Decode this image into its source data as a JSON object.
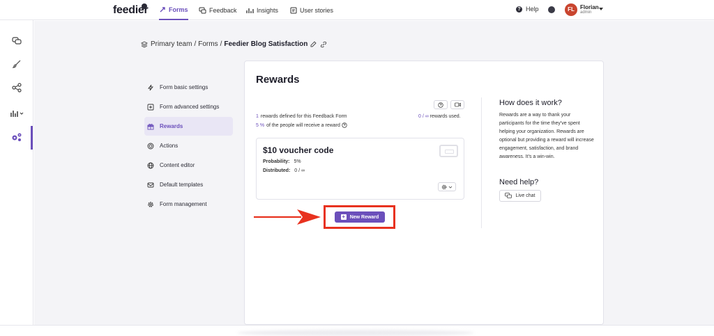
{
  "header": {
    "logo": "feedier",
    "nav": [
      {
        "label": "Forms",
        "active": true
      },
      {
        "label": "Feedback",
        "active": false
      },
      {
        "label": "Insights",
        "active": false
      },
      {
        "label": "User stories",
        "active": false
      }
    ],
    "help_label": "Help",
    "user": {
      "initials": "FL",
      "name": "Florian",
      "role": "admin"
    }
  },
  "breadcrumb": {
    "team": "Primary team",
    "forms": "Forms",
    "current": "Feedier Blog Satisfaction"
  },
  "settings_menu": [
    {
      "label": "Form basic settings",
      "icon": "lightning-icon"
    },
    {
      "label": "Form advanced settings",
      "icon": "plus-square-icon"
    },
    {
      "label": "Rewards",
      "icon": "gift-icon",
      "active": true
    },
    {
      "label": "Actions",
      "icon": "target-icon"
    },
    {
      "label": "Content editor",
      "icon": "globe-icon"
    },
    {
      "label": "Default templates",
      "icon": "mail-icon"
    },
    {
      "label": "Form management",
      "icon": "gear-icon"
    }
  ],
  "rewards": {
    "title": "Rewards",
    "defined_count": "1",
    "defined_text": "rewards defined for this Feedback Form",
    "percent": "5 %",
    "percent_text": "of the people will receive a reward",
    "used_value": "0 / ∞",
    "used_text": "rewards used."
  },
  "reward_card": {
    "title": "$10 voucher code",
    "probability_label": "Probability:",
    "probability_value": "5%",
    "distributed_label": "Distributed:",
    "distributed_value": "0 / ∞"
  },
  "new_reward_button": "New Reward",
  "help_panel": {
    "how_title": "How does it work?",
    "how_text": "Rewards are a way to thank your participants for the time they've spent helping your organization. Rewards are optional but providing a reward will increase engagement, satisfaction, and brand awareness. It's a win-win.",
    "need_title": "Need help?",
    "live_chat": "Live chat"
  },
  "colors": {
    "accent": "#6b4fbb",
    "highlight": "#e8321f",
    "avatar": "#c9452f"
  }
}
